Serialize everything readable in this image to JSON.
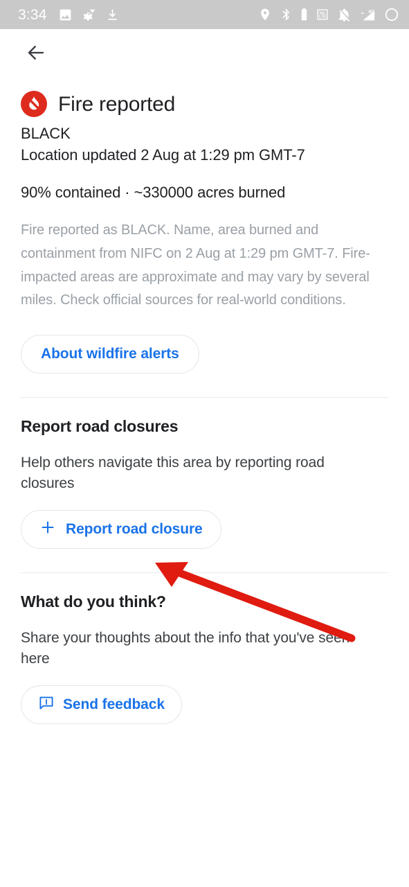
{
  "status_bar": {
    "clock": "3:34",
    "left_icons": [
      "image-icon",
      "gear-wifi-icon",
      "download-icon"
    ],
    "right_icons": [
      "location-pin-icon",
      "bluetooth-icon",
      "battery-vertical-icon",
      "volte-icon",
      "notifications-muted-icon",
      "signal-4g-icon",
      "battery-ring-icon"
    ],
    "volte_top": "VoL",
    "volte_bottom": "LTE",
    "network_label": "4G",
    "background_color": "#c9c9c9"
  },
  "navbar": {
    "back_label": "Back",
    "back_icon": "arrow-back-icon"
  },
  "alert": {
    "icon": "fire-alert-icon",
    "icon_color": "#dd2c1e",
    "title": "Fire reported",
    "name": "BLACK",
    "updated": "Location updated 2 Aug at 1:29 pm GMT-7",
    "stats": "90% contained · ~330000 acres burned",
    "description": "Fire reported as BLACK. Name, area burned and containment from NIFC on 2 Aug at 1:29 pm GMT-7. Fire-impacted areas are approximate and may vary by several miles. Check official sources for real-world conditions.",
    "about_button": "About wildfire alerts"
  },
  "road_closures": {
    "heading": "Report road closures",
    "body": "Help others navigate this area by reporting road closures",
    "button_label": "Report road closure",
    "button_icon": "plus-icon"
  },
  "feedback": {
    "heading": "What do you think?",
    "body": "Share your thoughts about the info that you've seen here",
    "button_label": "Send feedback",
    "button_icon": "feedback-bubble-icon"
  },
  "annotation": {
    "type": "arrow",
    "color": "#e01b10",
    "points_to": "report-road-closure-button"
  },
  "theme": {
    "accent_blue": "#1a73e8",
    "text_primary": "#202124",
    "text_muted": "#9aa0a6",
    "divider": "#e8eaed"
  }
}
